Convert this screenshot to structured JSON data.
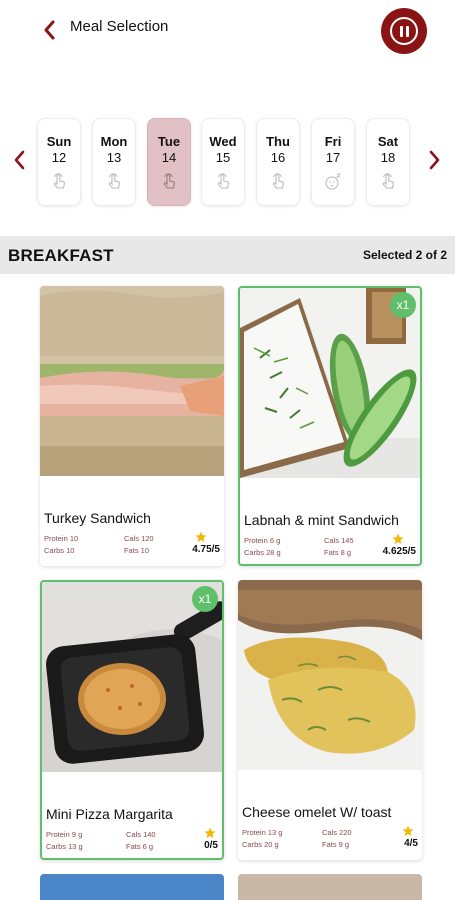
{
  "header": {
    "title": "Meal Selection",
    "back_icon": "chevron-left-icon",
    "pause_icon": "pause-icon",
    "accent_color": "#8a1414"
  },
  "week": {
    "days": [
      {
        "name": "Sun",
        "num": "12",
        "icon": "tap-icon",
        "selected": false
      },
      {
        "name": "Mon",
        "num": "13",
        "icon": "tap-icon",
        "selected": false
      },
      {
        "name": "Tue",
        "num": "14",
        "icon": "tap-icon",
        "selected": true
      },
      {
        "name": "Wed",
        "num": "15",
        "icon": "tap-icon",
        "selected": false
      },
      {
        "name": "Thu",
        "num": "16",
        "icon": "tap-icon",
        "selected": false
      },
      {
        "name": "Fri",
        "num": "17",
        "icon": "sleep-icon",
        "selected": false
      },
      {
        "name": "Sat",
        "num": "18",
        "icon": "tap-icon",
        "selected": false
      }
    ]
  },
  "section": {
    "title": "BREAKFAST",
    "count": "Selected 2 of 2"
  },
  "meals": [
    {
      "name": "Turkey Sandwich",
      "protein": "Protein 10",
      "carbs": "Carbs 10",
      "cals": "Cals 120",
      "fats": "Fats 10",
      "rating": "4.75/5",
      "selected": false,
      "badge": ""
    },
    {
      "name": "Labnah & mint Sandwich",
      "protein": "Protein 6 g",
      "carbs": "Carbs 28 g",
      "cals": "Cals 145",
      "fats": "Fats 8 g",
      "rating": "4.625/5",
      "selected": true,
      "badge": "x1"
    },
    {
      "name": "Mini Pizza Margarita",
      "protein": "Protein 9 g",
      "carbs": "Carbs 13 g",
      "cals": "Cals 140",
      "fats": "Fats 6 g",
      "rating": "0/5",
      "selected": true,
      "badge": "x1"
    },
    {
      "name": "Cheese omelet W/ toast",
      "protein": "Protein 13 g",
      "carbs": "Carbs 20 g",
      "cals": "Cals 220",
      "fats": "Fats 9 g",
      "rating": "4/5",
      "selected": false,
      "badge": ""
    }
  ],
  "colors": {
    "selected_day": "#e2c1c6",
    "selected_border": "#5fbf6a",
    "star": "#f2b705"
  }
}
